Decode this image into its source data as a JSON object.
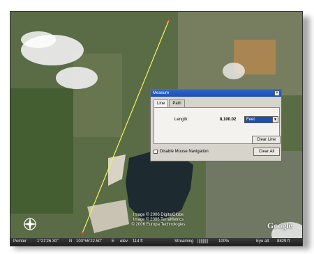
{
  "colors": {
    "dialog_title_bg": "#1c4fb3",
    "measure_line": "#f6f25a",
    "status_bg": "#2a2a2a"
  },
  "measure_dialog": {
    "title": "Measure",
    "close_label": "×",
    "tabs": [
      {
        "label": "Line"
      },
      {
        "label": "Path"
      }
    ],
    "active_tab": "Line",
    "length_label": "Length:",
    "length_value": "8,100.02",
    "unit_selected": "Feet",
    "clear_line_label": "Clear Line",
    "disable_nav_label": "Disable Mouse Navigation",
    "disable_nav_checked": false,
    "clear_all_label": "Clear All"
  },
  "map": {
    "copyright_lines": [
      "Image © 2006 DigitalGlobe",
      "Image © 2006 TerraMetrics",
      "© 2006 Europa Technologies"
    ],
    "logo_text": "Google",
    "compass_icon": "compass-icon"
  },
  "status": {
    "pointer_label": "Pointer",
    "lat": "1°21'26.30\"",
    "lat_dir": "N",
    "lon": "103°55'22.50\"",
    "lon_dir": "E",
    "elev": "elev",
    "elev_value": "114 ft",
    "streaming_label": "Streaming",
    "streaming_bar": "||||||||||",
    "streaming_pct": "100%",
    "eye_label": "Eye alt",
    "eye_value": "8829 ft"
  }
}
